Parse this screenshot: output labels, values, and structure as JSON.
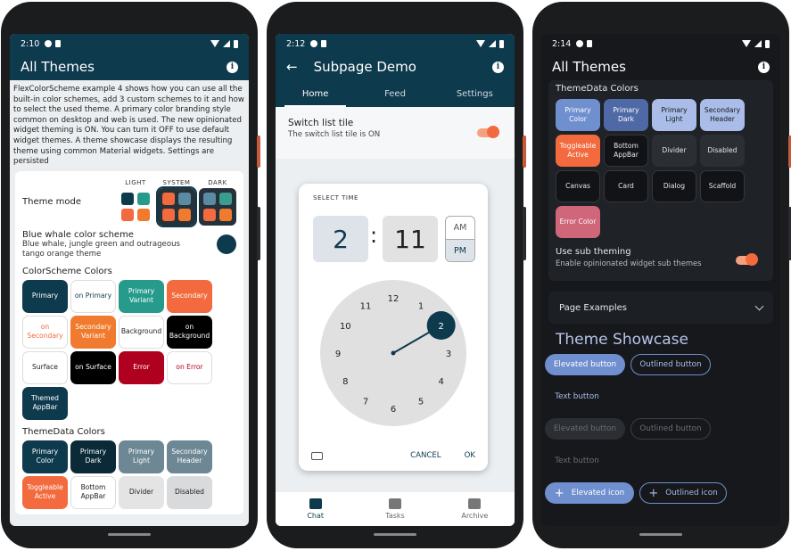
{
  "phone1": {
    "status_time": "2:10",
    "title": "All Themes",
    "intro": "FlexColorScheme example 4 shows how you can use all the built-in color schemes, add 3 custom schemes to it and how to select the used theme. A primary color branding style common on desktop and web is used. The new opinionated widget theming is ON. You can turn it OFF to use default widget themes. A theme showcase displays the resulting theme using common Material widgets. Settings are persisted",
    "theme_mode_label": "Theme mode",
    "theme_modes": [
      "LIGHT",
      "SYSTEM",
      "DARK"
    ],
    "scheme_title": "Blue whale color scheme",
    "scheme_sub": "Blue whale, jungle green and outrageous tango orange theme",
    "colorscheme_title": "ColorScheme Colors",
    "colorscheme_chips": [
      {
        "label": "Primary",
        "bg": "#0e3a4e",
        "fg": "#ffffff"
      },
      {
        "label": "on Primary",
        "bg": "#ffffff",
        "fg": "#0e3a4e"
      },
      {
        "label": "Primary Variant",
        "bg": "#269b8c",
        "fg": "#ffffff"
      },
      {
        "label": "Secondary",
        "bg": "#f26a3d",
        "fg": "#ffffff"
      },
      {
        "label": "on Secondary",
        "bg": "#ffffff",
        "fg": "#f26a3d"
      },
      {
        "label": "Secondary Variant",
        "bg": "#f07a2d",
        "fg": "#ffffff"
      },
      {
        "label": "Background",
        "bg": "#ffffff",
        "fg": "#222222"
      },
      {
        "label": "on Background",
        "bg": "#000000",
        "fg": "#ffffff"
      },
      {
        "label": "Surface",
        "bg": "#ffffff",
        "fg": "#222222"
      },
      {
        "label": "on Surface",
        "bg": "#000000",
        "fg": "#ffffff"
      },
      {
        "label": "Error",
        "bg": "#b00020",
        "fg": "#ffffff"
      },
      {
        "label": "on Error",
        "bg": "#ffffff",
        "fg": "#b00020"
      },
      {
        "label": "Themed AppBar",
        "bg": "#0e3a4e",
        "fg": "#ffffff"
      }
    ],
    "themedata_title": "ThemeData Colors",
    "themedata_chips": [
      {
        "label": "Primary Color",
        "bg": "#0e3a4e",
        "fg": "#ffffff"
      },
      {
        "label": "Primary Dark",
        "bg": "#0a2a38",
        "fg": "#ffffff"
      },
      {
        "label": "Primary Light",
        "bg": "#6d8794",
        "fg": "#ffffff"
      },
      {
        "label": "Secondary Header",
        "bg": "#6d8794",
        "fg": "#ffffff"
      },
      {
        "label": "Toggleable Active",
        "bg": "#f26a3d",
        "fg": "#ffffff"
      },
      {
        "label": "Bottom AppBar",
        "bg": "#ffffff",
        "fg": "#222222"
      },
      {
        "label": "Divider",
        "bg": "#e4e4e4",
        "fg": "#222222"
      },
      {
        "label": "Disabled",
        "bg": "#d8dadc",
        "fg": "#222222"
      }
    ]
  },
  "phone2": {
    "status_time": "2:12",
    "title": "Subpage Demo",
    "tabs": [
      "Home",
      "Feed",
      "Settings"
    ],
    "switch_title": "Switch list tile",
    "switch_sub": "The switch list tile is ON",
    "picker": {
      "label": "SELECT TIME",
      "hour": "2",
      "minute": "11",
      "am": "AM",
      "pm": "PM",
      "cancel": "CANCEL",
      "ok": "OK",
      "dial_numbers": [
        "12",
        "1",
        "2",
        "3",
        "4",
        "5",
        "6",
        "7",
        "8",
        "9",
        "10",
        "11"
      ],
      "selected_minute": 11
    },
    "nav": [
      {
        "label": "Chat",
        "icon": "chat-icon"
      },
      {
        "label": "Tasks",
        "icon": "tasks-icon"
      },
      {
        "label": "Archive",
        "icon": "archive-icon"
      }
    ],
    "colors": {
      "primary": "#0e3a4e",
      "accent": "#f26a3d"
    }
  },
  "phone3": {
    "status_time": "2:14",
    "title": "All Themes",
    "themedata_title": "ThemeData Colors",
    "themedata_chips": [
      {
        "label": "Primary Color",
        "bg": "#6f8fcf",
        "fg": "#ffffff"
      },
      {
        "label": "Primary Dark",
        "bg": "#4f69a6",
        "fg": "#ffffff"
      },
      {
        "label": "Primary Light",
        "bg": "#a9bde8",
        "fg": "#16181c"
      },
      {
        "label": "Secondary Header",
        "bg": "#a9bde8",
        "fg": "#16181c"
      },
      {
        "label": "Toggleable Active",
        "bg": "#f26a3d",
        "fg": "#ffffff"
      },
      {
        "label": "Bottom AppBar",
        "bg": "#121316",
        "fg": "#e6e6e6"
      },
      {
        "label": "Divider",
        "bg": "#2b2e33",
        "fg": "#e6e6e6"
      },
      {
        "label": "Disabled",
        "bg": "#2b2e33",
        "fg": "#e6e6e6"
      },
      {
        "label": "Canvas",
        "bg": "#121316",
        "fg": "#e6e6e6"
      },
      {
        "label": "Card",
        "bg": "#121316",
        "fg": "#e6e6e6"
      },
      {
        "label": "Dialog",
        "bg": "#121316",
        "fg": "#e6e6e6"
      },
      {
        "label": "Scaffold",
        "bg": "#121316",
        "fg": "#e6e6e6"
      },
      {
        "label": "Error Color",
        "bg": "#cf6679",
        "fg": "#ffffff"
      }
    ],
    "sub_theming_title": "Use sub theming",
    "sub_theming_sub": "Enable opinionated widget sub themes",
    "page_examples": "Page Examples",
    "showcase_title": "Theme Showcase",
    "buttons": {
      "elevated": "Elevated button",
      "outlined": "Outlined button",
      "text": "Text button",
      "elevated_disabled": "Elevated button",
      "outlined_disabled": "Outlined button",
      "text_disabled": "Text button",
      "elevated_icon": "Elevated icon",
      "outlined_icon": "Outlined icon"
    },
    "colors": {
      "primary": "#6f8fcf",
      "accent": "#f26a3d"
    }
  }
}
